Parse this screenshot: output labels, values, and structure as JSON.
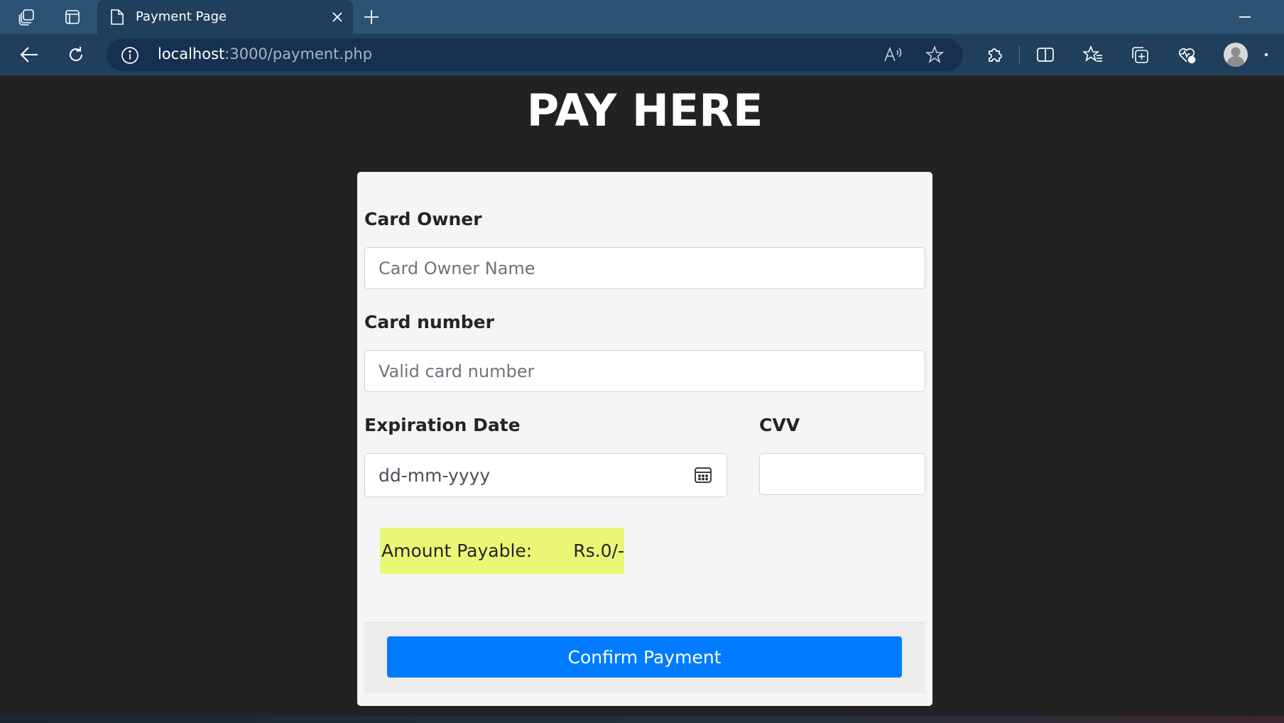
{
  "browser": {
    "tab": {
      "title": "Payment Page"
    },
    "address": {
      "host": "localhost",
      "path": ":3000/payment.php"
    },
    "icons": {
      "workspaces": "workspaces-icon",
      "tab_actions": "tab-actions-icon",
      "page": "page-icon",
      "close": "close-icon",
      "new_tab": "plus-icon",
      "minimize": "minimize-icon",
      "back": "back-arrow-icon",
      "refresh": "refresh-icon",
      "info": "info-icon",
      "read_aloud": "read-aloud-icon",
      "favorite": "star-icon",
      "extensions": "puzzle-icon",
      "split_screen": "split-screen-icon",
      "favorites": "favorites-icon",
      "collections": "collections-icon",
      "health": "browser-essentials-icon",
      "profile": "profile-avatar-icon",
      "more": "more-icon"
    }
  },
  "page": {
    "title": "PAY HERE",
    "form": {
      "card_owner": {
        "label": "Card Owner",
        "placeholder": "Card Owner Name",
        "value": ""
      },
      "card_number": {
        "label": "Card number",
        "placeholder": "Valid card number",
        "value": ""
      },
      "expiration": {
        "label": "Expiration Date",
        "placeholder": "dd-mm-yyyy"
      },
      "cvv": {
        "label": "CVV",
        "value": ""
      },
      "amount": {
        "label": "Amount Payable:",
        "value": "Rs.0/-"
      },
      "confirm_label": "Confirm Payment"
    }
  },
  "colors": {
    "page_bg": "#222222",
    "card_bg": "#f5f5f5",
    "amount_bg": "#e9f774",
    "button_bg": "#007bff",
    "tabstrip_bg": "#2c5274",
    "toolbar_bg": "#1f3f5d"
  }
}
